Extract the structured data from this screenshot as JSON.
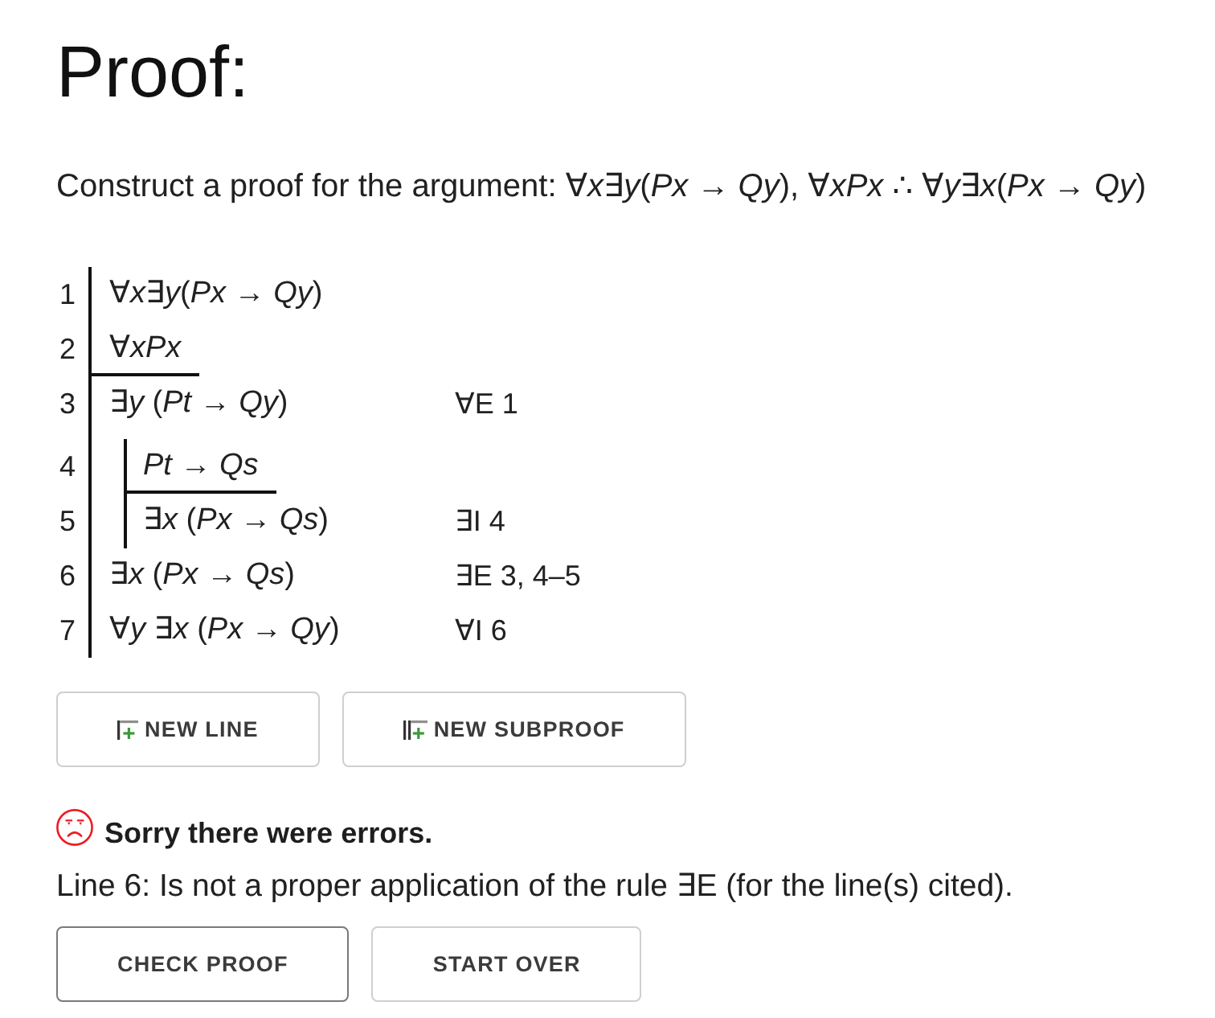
{
  "title": "Proof:",
  "prompt": "Construct a proof for the argument: ∀*x*∃*y*(*Px* → *Qy*), ∀*xPx* ∴ ∀*y*∃*x*(*Px* → *Qy*)",
  "proof": [
    {
      "kind": "premise",
      "number": "1",
      "formula": "∀*x*∃*y*(*Px* → *Qy*)"
    },
    {
      "kind": "premise",
      "number": "2",
      "formula": "∀*xPx*"
    },
    {
      "kind": "line",
      "number": "3",
      "formula": "∃*y* (*Pt* → *Qy*)",
      "justification": "∀E 1"
    },
    {
      "kind": "subproof",
      "children": [
        {
          "kind": "assumption",
          "number": "4",
          "formula": "*Pt* → *Qs*"
        },
        {
          "kind": "line",
          "number": "5",
          "formula": "∃*x* (*Px* → *Qs*)",
          "justification": "∃I 4"
        }
      ]
    },
    {
      "kind": "line",
      "number": "6",
      "formula": "∃*x* (*Px* → *Qs*)",
      "justification": "∃E 3, 4–5"
    },
    {
      "kind": "line",
      "number": "7",
      "formula": "∀*y* ∃*x* (*Px* → *Qy*)",
      "justification": "∀I 6"
    }
  ],
  "edit_buttons": [
    {
      "kind": "new-line",
      "label": "NEW LINE"
    },
    {
      "kind": "new-subproof",
      "label": "NEW SUBPROOF"
    }
  ],
  "feedback": {
    "failed": true,
    "heading": "Sorry there were errors.",
    "messages": [
      "Line 6: Is not a proper application of the rule ∃E (for the line(s) cited)."
    ]
  },
  "actions": [
    {
      "label": "CHECK PROOF",
      "focused": true
    },
    {
      "label": "START OVER",
      "focused": false
    }
  ]
}
